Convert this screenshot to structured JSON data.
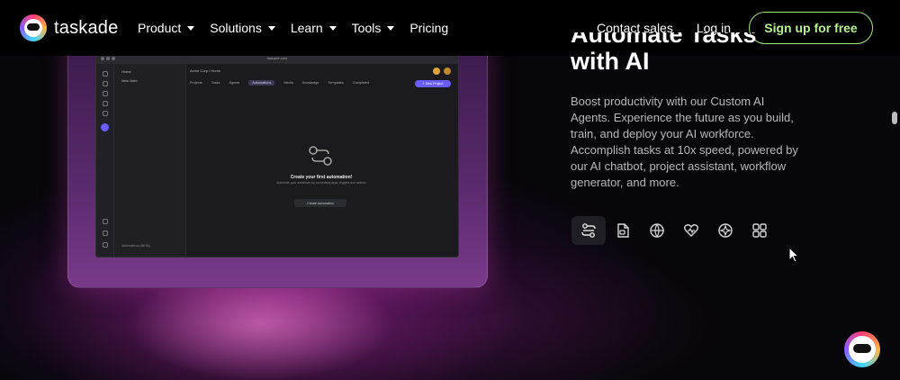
{
  "brand": {
    "name": "taskade"
  },
  "nav": {
    "items": [
      {
        "label": "Product",
        "has_dropdown": true
      },
      {
        "label": "Solutions",
        "has_dropdown": true
      },
      {
        "label": "Learn",
        "has_dropdown": true
      },
      {
        "label": "Tools",
        "has_dropdown": true
      },
      {
        "label": "Pricing",
        "has_dropdown": false
      }
    ],
    "contact_label": "Contact sales",
    "login_label": "Log in",
    "signup_label": "Sign up for free"
  },
  "hero": {
    "headline_line1": "Automate Tasks",
    "headline_line2": "with AI",
    "description": "Boost productivity with our Custom AI Agents. Experience the future as you build, train, and deploy your AI workforce. Accomplish tasks at 10x speed, powered by our AI chatbot, project assistant, workflow generator, and more."
  },
  "features": [
    {
      "icon": "automation-icon",
      "active": true
    },
    {
      "icon": "document-ai-icon",
      "active": false
    },
    {
      "icon": "globe-icon",
      "active": false
    },
    {
      "icon": "heart-pulse-icon",
      "active": false
    },
    {
      "icon": "sparkle-icon",
      "active": false
    },
    {
      "icon": "grid-apps-icon",
      "active": false
    }
  ],
  "mockup": {
    "url": "taskade.com",
    "panel_items": [
      "Home",
      "New Note"
    ],
    "crumb": "Acme Corp  /  Home",
    "tabs": [
      "Projects",
      "Tasks",
      "Agents",
      "Automations",
      "Media",
      "Knowledge",
      "Templates",
      "Completed"
    ],
    "active_tab": "Automations",
    "new_button": "+ New Project",
    "empty_title": "Create your first automation!",
    "empty_subtitle": "Automate your workflows by connecting apps, triggers and actions",
    "create_button": "Create Automation",
    "panel_footer": "Automations (BETA)"
  },
  "colors": {
    "accent_green": "#a3e87a",
    "brand_purple": "#6a5cff",
    "background": "#07060a"
  }
}
